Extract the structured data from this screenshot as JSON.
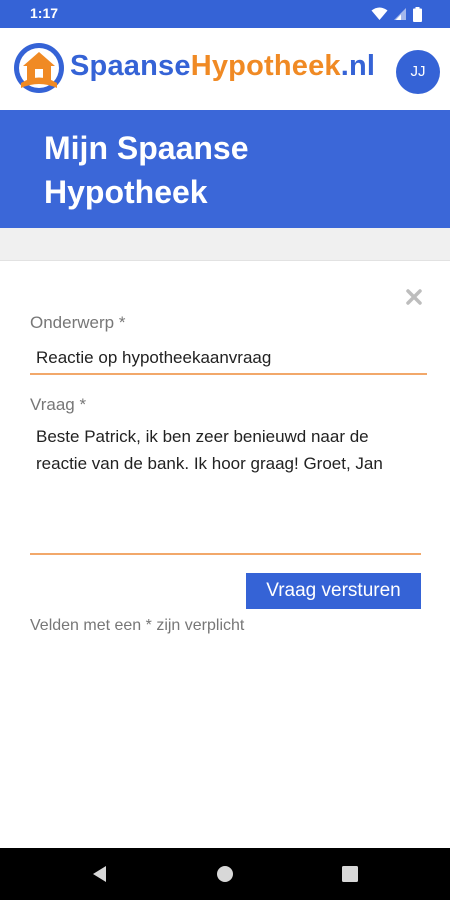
{
  "status_bar": {
    "time": "1:17",
    "icons": [
      "wifi-icon",
      "signal-icon",
      "battery-icon"
    ]
  },
  "header": {
    "brand_part1": "Spaanse",
    "brand_part2": "Hypotheek",
    "brand_part3": ".nl",
    "avatar_initials": "JJ",
    "logo_icon": "house-logo-icon",
    "colors": {
      "blue": "#3563d6",
      "orange": "#f08a24"
    }
  },
  "page_title": "Mijn Spaanse Hypotheek",
  "form": {
    "close_icon": "close-icon",
    "subject_label": "Onderwerp *",
    "subject_value": "Reactie op hypotheekaanvraag",
    "question_label": "Vraag *",
    "question_value": "Beste Patrick, ik ben zeer benieuwd naar de reactie van de bank. Ik hoor graag! Groet, Jan",
    "submit_label": "Vraag versturen",
    "required_note": "Velden met een * zijn verplicht"
  },
  "nav_bar": {
    "icons": [
      "back-icon",
      "home-icon",
      "recents-icon"
    ]
  }
}
